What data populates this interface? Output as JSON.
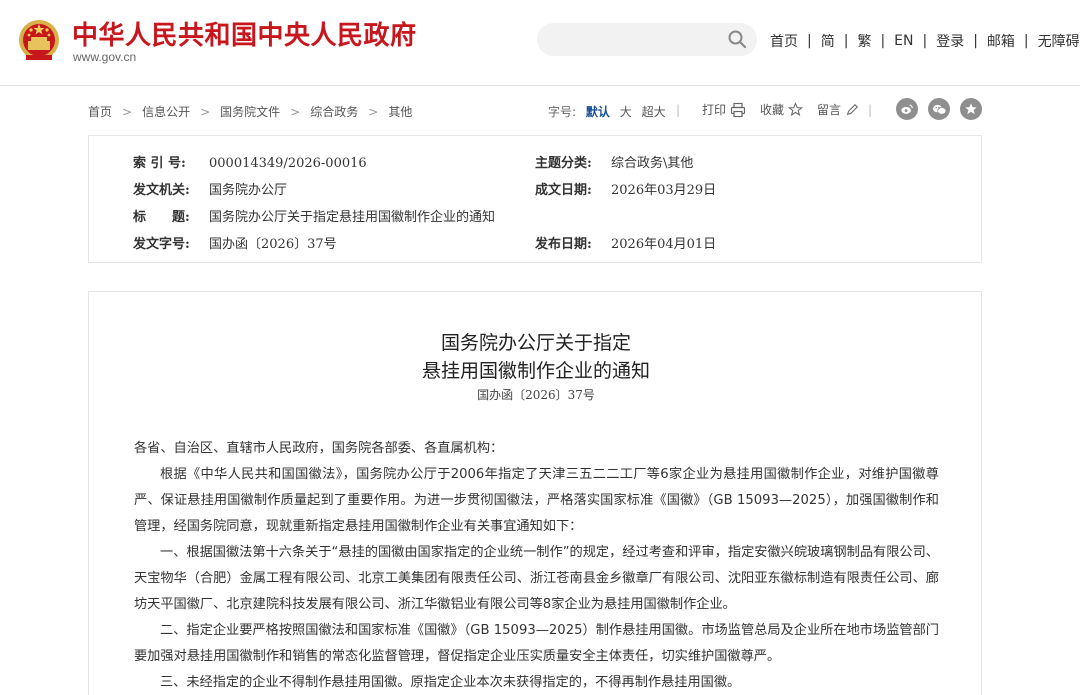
{
  "header": {
    "site_title": "中华人民共和国中央人民政府",
    "site_url": "www.gov.cn",
    "search": {
      "placeholder": "",
      "value": ""
    },
    "nav": [
      "首页",
      "简",
      "繁",
      "EN",
      "登录",
      "邮箱",
      "无障碍"
    ],
    "nav_separator": "|"
  },
  "toolbar": {
    "breadcrumb": [
      "首页",
      "信息公开",
      "国务院文件",
      "综合政务",
      "其他"
    ],
    "breadcrumb_arrow": ">",
    "font_size_label": "字号:",
    "font_options": [
      "默认",
      "大",
      "超大"
    ],
    "print_label": "打印",
    "favorite_label": "收藏",
    "comment_label": "留言",
    "divider": "|"
  },
  "info": {
    "index_label": "索 引 号:",
    "index_value": "000014349/2026-00016",
    "category_label": "主题分类:",
    "category_value": "综合政务\\其他",
    "issuer_label": "发文机关:",
    "issuer_value": "国务院办公厅",
    "date_label": "成文日期:",
    "date_value": "2026年03月29日",
    "title_label": "标　　题:",
    "title_value": "国务院办公厅关于指定悬挂用国徽制作企业的通知",
    "docno_label": "发文字号:",
    "docno_value": "国办函〔2026〕37号",
    "publish_label": "发布日期:",
    "publish_value": "2026年04月01日"
  },
  "article": {
    "title_line1": "国务院办公厅关于指定",
    "title_line2": "悬挂用国徽制作企业的通知",
    "doc_number": "国办函〔2026〕37号",
    "salutation": "各省、自治区、直辖市人民政府，国务院各部委、各直属机构：",
    "paragraphs": [
      "根据《中华人民共和国国徽法》，国务院办公厅于2006年指定了天津三五二二工厂等6家企业为悬挂用国徽制作企业，对维护国徽尊严、保证悬挂用国徽制作质量起到了重要作用。为进一步贯彻国徽法，严格落实国家标准《国徽》（GB 15093—2025），加强国徽制作和管理，经国务院同意，现就重新指定悬挂用国徽制作企业有关事宜通知如下：",
      "一、根据国徽法第十六条关于“悬挂的国徽由国家指定的企业统一制作”的规定，经过考查和评审，指定安徽兴皖玻璃钢制品有限公司、天宝物华（合肥）金属工程有限公司、北京工美集团有限责任公司、浙江苍南县金乡徽章厂有限公司、沈阳亚东徽标制造有限责任公司、廊坊天平国徽厂、北京建院科技发展有限公司、浙江华徽铝业有限公司等8家企业为悬挂用国徽制作企业。",
      "二、指定企业要严格按照国徽法和国家标准《国徽》（GB 15093—2025）制作悬挂用国徽。市场监管总局及企业所在地市场监管部门要加强对悬挂用国徽制作和销售的常态化监督管理，督促指定企业压实质量安全主体责任，切实维护国徽尊严。",
      "三、未经指定的企业不得制作悬挂用国徽。原指定企业本次未获得指定的，不得再制作悬挂用国徽。"
    ]
  },
  "colors": {
    "title_red": "#c8161d",
    "accent_blue": "#1a4f9c",
    "social_gray": "#8f8f8f"
  },
  "icons": [
    "national-emblem-icon",
    "search-icon",
    "print-icon",
    "star-icon",
    "pencil-icon",
    "weibo-icon",
    "wechat-icon",
    "favorite-circle-icon"
  ]
}
